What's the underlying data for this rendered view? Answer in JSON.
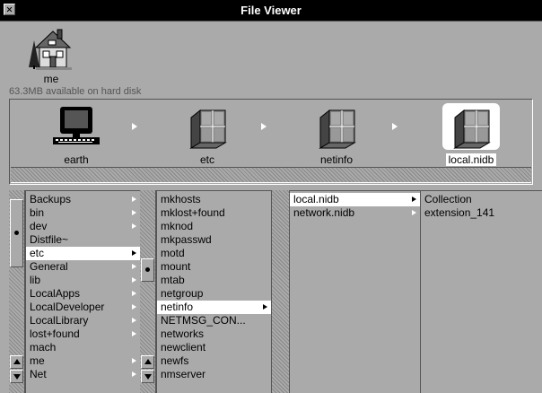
{
  "window": {
    "title": "File Viewer"
  },
  "shelf": {
    "home_label": "me",
    "disk_info": "63.3MB available on hard disk"
  },
  "path": {
    "items": [
      {
        "label": "earth",
        "icon": "computer-icon"
      },
      {
        "label": "etc",
        "icon": "folder-icon"
      },
      {
        "label": "netinfo",
        "icon": "folder-icon"
      },
      {
        "label": "local.nidb",
        "icon": "folder-icon",
        "selected": true
      }
    ]
  },
  "columns": [
    {
      "items": [
        {
          "label": "Backups",
          "folder": true
        },
        {
          "label": "bin",
          "folder": true
        },
        {
          "label": "dev",
          "folder": true
        },
        {
          "label": "Distfile~",
          "folder": false
        },
        {
          "label": "etc",
          "folder": true,
          "selected": true
        },
        {
          "label": "General",
          "folder": true
        },
        {
          "label": "lib",
          "folder": true
        },
        {
          "label": "LocalApps",
          "folder": true
        },
        {
          "label": "LocalDeveloper",
          "folder": true
        },
        {
          "label": "LocalLibrary",
          "folder": true
        },
        {
          "label": "lost+found",
          "folder": true
        },
        {
          "label": "mach",
          "folder": false
        },
        {
          "label": "me",
          "folder": true
        },
        {
          "label": "Net",
          "folder": true
        }
      ]
    },
    {
      "items": [
        {
          "label": "mkhosts",
          "folder": false
        },
        {
          "label": "mklost+found",
          "folder": false
        },
        {
          "label": "mknod",
          "folder": false
        },
        {
          "label": "mkpasswd",
          "folder": false
        },
        {
          "label": "motd",
          "folder": false
        },
        {
          "label": "mount",
          "folder": false
        },
        {
          "label": "mtab",
          "folder": false
        },
        {
          "label": "netgroup",
          "folder": false
        },
        {
          "label": "netinfo",
          "folder": true,
          "selected": true
        },
        {
          "label": "NETMSG_CON...",
          "folder": false
        },
        {
          "label": "networks",
          "folder": false
        },
        {
          "label": "newclient",
          "folder": false
        },
        {
          "label": "newfs",
          "folder": false
        },
        {
          "label": "nmserver",
          "folder": false
        }
      ]
    },
    {
      "items": [
        {
          "label": "local.nidb",
          "folder": true,
          "selected": true
        },
        {
          "label": "network.nidb",
          "folder": true
        }
      ]
    },
    {
      "items": [
        {
          "label": "Collection",
          "folder": false
        },
        {
          "label": "extension_141",
          "folder": false
        }
      ]
    }
  ]
}
